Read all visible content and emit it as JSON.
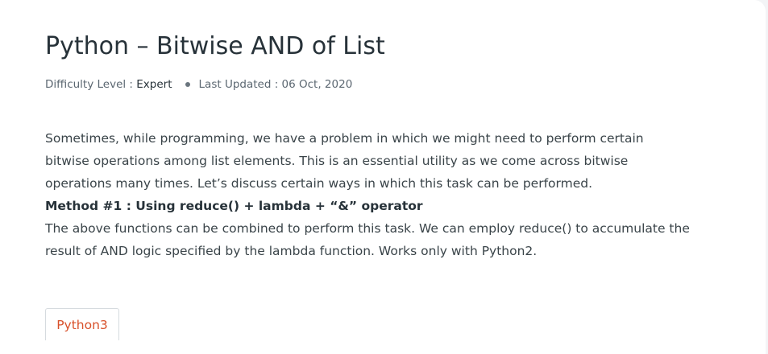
{
  "article": {
    "title": "Python – Bitwise AND of List",
    "meta": {
      "difficulty_label": "Difficulty Level : ",
      "difficulty_value": "Expert",
      "updated_label": "Last Updated : 06 Oct, 2020"
    },
    "paragraphs": [
      "Sometimes, while programming, we have a problem in which we might need to perform certain bitwise operations among list elements. This is an essential utility as we come across bitwise operations many times. Let’s discuss certain ways in which this task can be performed."
    ],
    "method_heading": "Method #1 : Using reduce() + lambda + “&” operator",
    "method_paragraph": "The above functions can be combined to perform this task. We can employ reduce() to accumulate the result of AND logic specified by the lambda function. Works only with Python2.",
    "code_tabs": [
      {
        "label": "Python3"
      }
    ]
  },
  "colors": {
    "title": "#273239",
    "body_text": "#3a4449",
    "tab_accent": "#d8512b"
  }
}
